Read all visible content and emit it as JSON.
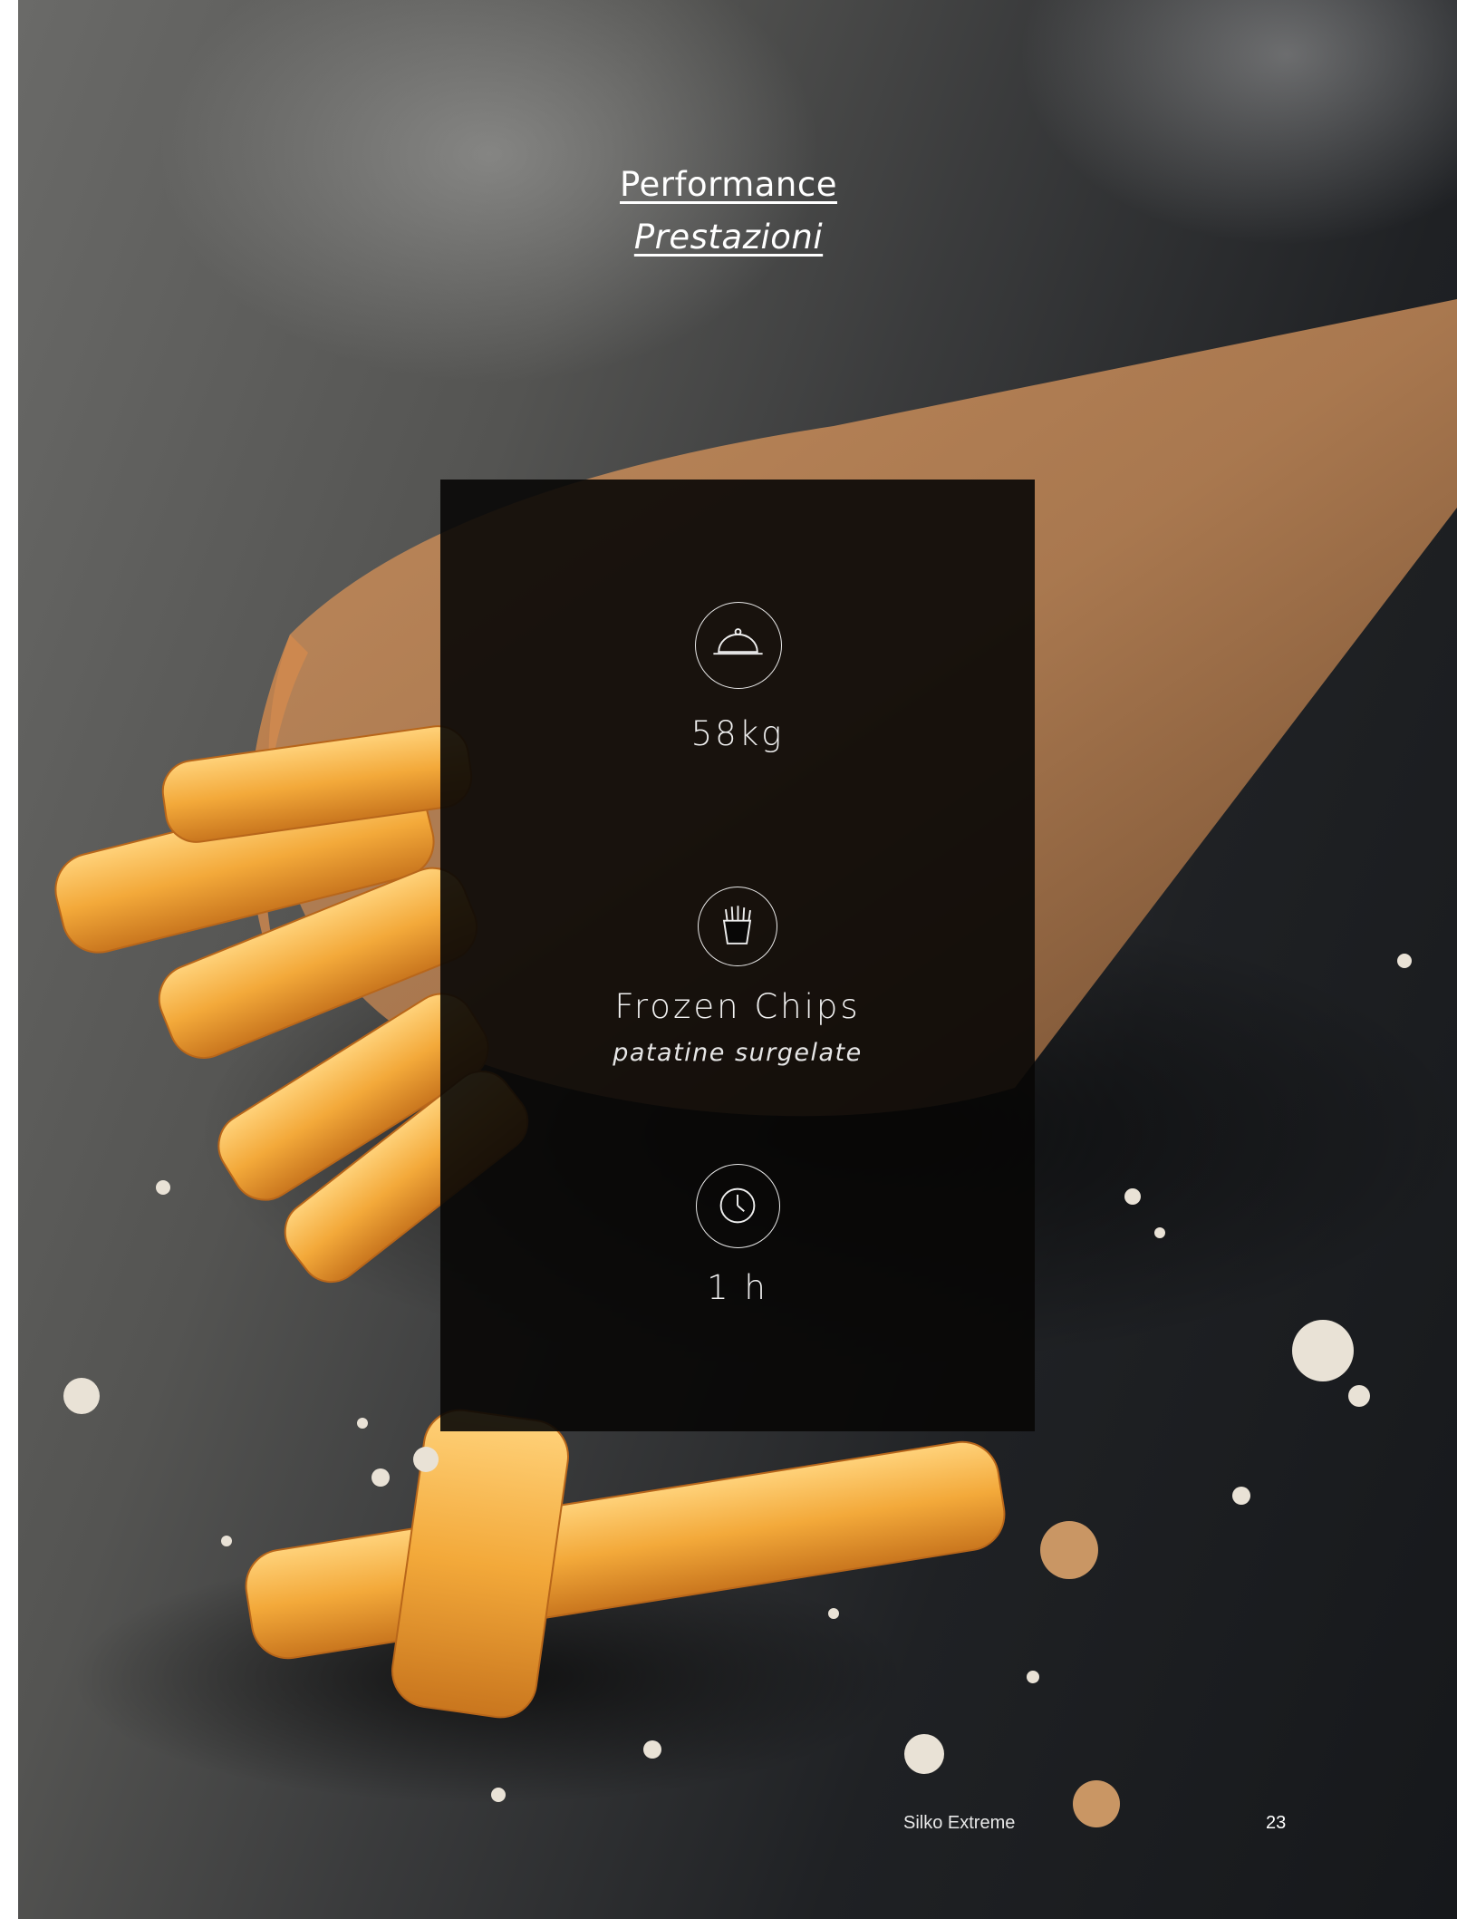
{
  "heading": {
    "title_en": "Performance",
    "title_it": "Prestazioni"
  },
  "stats": [
    {
      "icon": "cloche-icon",
      "value": "58kg"
    },
    {
      "icon": "fries-icon",
      "value": "Frozen Chips",
      "subtitle": "patatine surgelate"
    },
    {
      "icon": "clock-icon",
      "value": "1 h"
    }
  ],
  "footer": {
    "product": "Silko Extreme",
    "page_number": "23"
  },
  "colors": {
    "panel": "#080706",
    "text": "#ffffff",
    "fries": "#f0a830",
    "paper_cone": "#a9784f"
  }
}
